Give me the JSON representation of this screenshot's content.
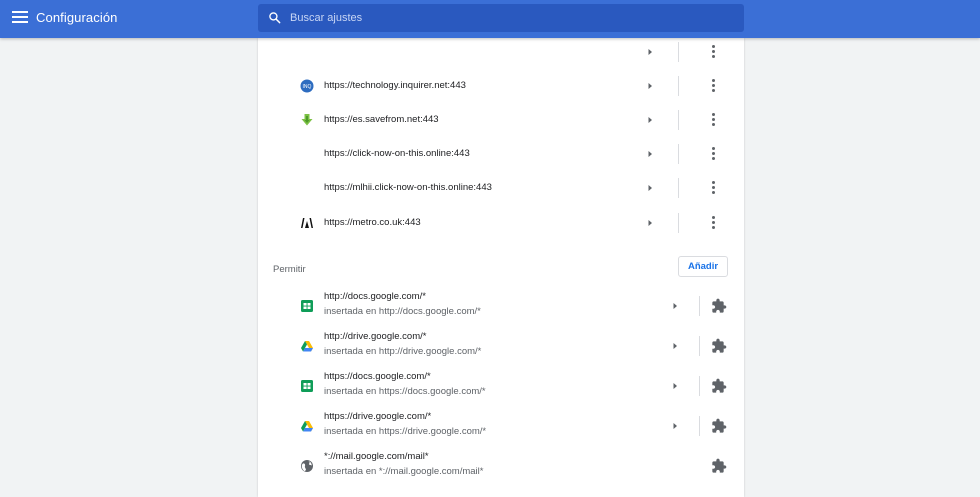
{
  "header": {
    "title": "Configuración",
    "menu_icon": "hamburger-menu-icon",
    "search": {
      "placeholder": "Buscar ajustes",
      "value": "",
      "icon": "search-icon"
    }
  },
  "colors": {
    "header_bg": "#3b6fd6",
    "search_bg": "#2a59bf",
    "accent": "#1a73e8",
    "page_bg": "#f1f3f4"
  },
  "blocked_sites": [
    {
      "url": "",
      "favicon": "none"
    },
    {
      "url": "https://technology.inquirer.net:443",
      "favicon": "inquirer-icon"
    },
    {
      "url": "https://es.savefrom.net:443",
      "favicon": "savefrom-download-icon"
    },
    {
      "url": "https://click-now-on-this.online:443",
      "favicon": "none"
    },
    {
      "url": "https://mlhii.click-now-on-this.online:443",
      "favicon": "none"
    },
    {
      "url": "https://metro.co.uk:443",
      "favicon": "metro-icon"
    }
  ],
  "allow_section": {
    "title": "Permitir",
    "add_label": "Añadir",
    "items": [
      {
        "url": "http://docs.google.com/*",
        "embedded": "insertada en http://docs.google.com/*",
        "favicon": "google-sheets-icon"
      },
      {
        "url": "http://drive.google.com/*",
        "embedded": "insertada en http://drive.google.com/*",
        "favicon": "google-drive-icon"
      },
      {
        "url": "https://docs.google.com/*",
        "embedded": "insertada en https://docs.google.com/*",
        "favicon": "google-sheets-icon"
      },
      {
        "url": "https://drive.google.com/*",
        "embedded": "insertada en https://drive.google.com/*",
        "favicon": "google-drive-icon"
      },
      {
        "url": "*://mail.google.com/mail*",
        "embedded": "insertada en *://mail.google.com/mail*",
        "favicon": "globe-icon"
      }
    ]
  }
}
